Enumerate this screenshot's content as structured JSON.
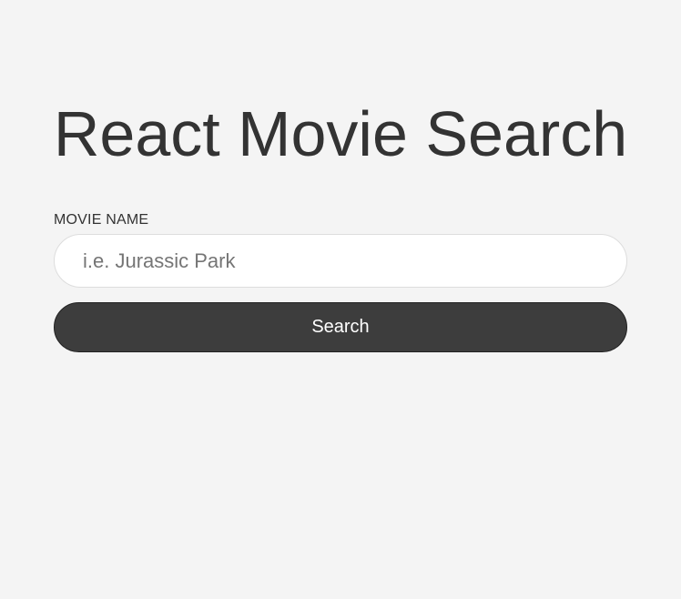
{
  "header": {
    "title": "React Movie Search"
  },
  "form": {
    "label": "MOVIE NAME",
    "input_value": "",
    "input_placeholder": "i.e. Jurassic Park",
    "search_label": "Search"
  },
  "colors": {
    "background": "#f4f4f4",
    "button": "#3d3d3d",
    "text": "#333333"
  }
}
